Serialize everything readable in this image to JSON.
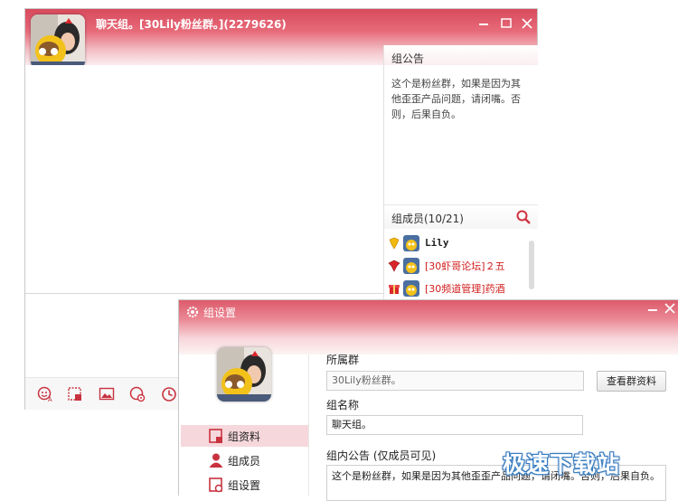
{
  "chat_window": {
    "title": "聊天组。[30Lily粉丝群。](2279626)",
    "notice": {
      "heading": "组公告",
      "body": "这个是粉丝群，如果是因为其他歪歪产品问题，请闭嘴。否则，后果自负。"
    },
    "members": {
      "heading": "组成员(10/21)",
      "list": [
        {
          "name": "Lily",
          "style": "black",
          "rank_icon": "yellow-rank-icon"
        },
        {
          "name": "[30虾哥论坛]２五",
          "style": "red",
          "rank_icon": "red-rank-icon"
        },
        {
          "name": "[30频道管理]药酒",
          "style": "red",
          "rank_icon": "gift-rank-icon"
        }
      ]
    },
    "toolbar": [
      "emoji-font-icon",
      "screenshot-icon",
      "image-icon",
      "settings-face-icon",
      "history-clock-icon"
    ]
  },
  "settings_window": {
    "title": "组设置",
    "nav": [
      {
        "label": "组资料",
        "icon": "group-info-icon",
        "active": true
      },
      {
        "label": "组成员",
        "icon": "group-members-icon",
        "active": false
      },
      {
        "label": "组设置",
        "icon": "group-settings-icon",
        "active": false
      }
    ],
    "form": {
      "parent_group_label": "所属群",
      "parent_group_value": "30Lily粉丝群。",
      "view_group_button": "查看群资料",
      "group_name_label": "组名称",
      "group_name_value": "聊天组。",
      "notice_label": "组内公告 (仅成员可见)",
      "notice_value": "这个是粉丝群，如果是因为其他歪歪产品问题，请闭嘴。否则，后果自负。"
    }
  },
  "watermark": "极速下载站",
  "colors": {
    "accent_red": "#d84a5c",
    "member_red": "#d21d1d",
    "active_nav": "#f6d8dc"
  }
}
